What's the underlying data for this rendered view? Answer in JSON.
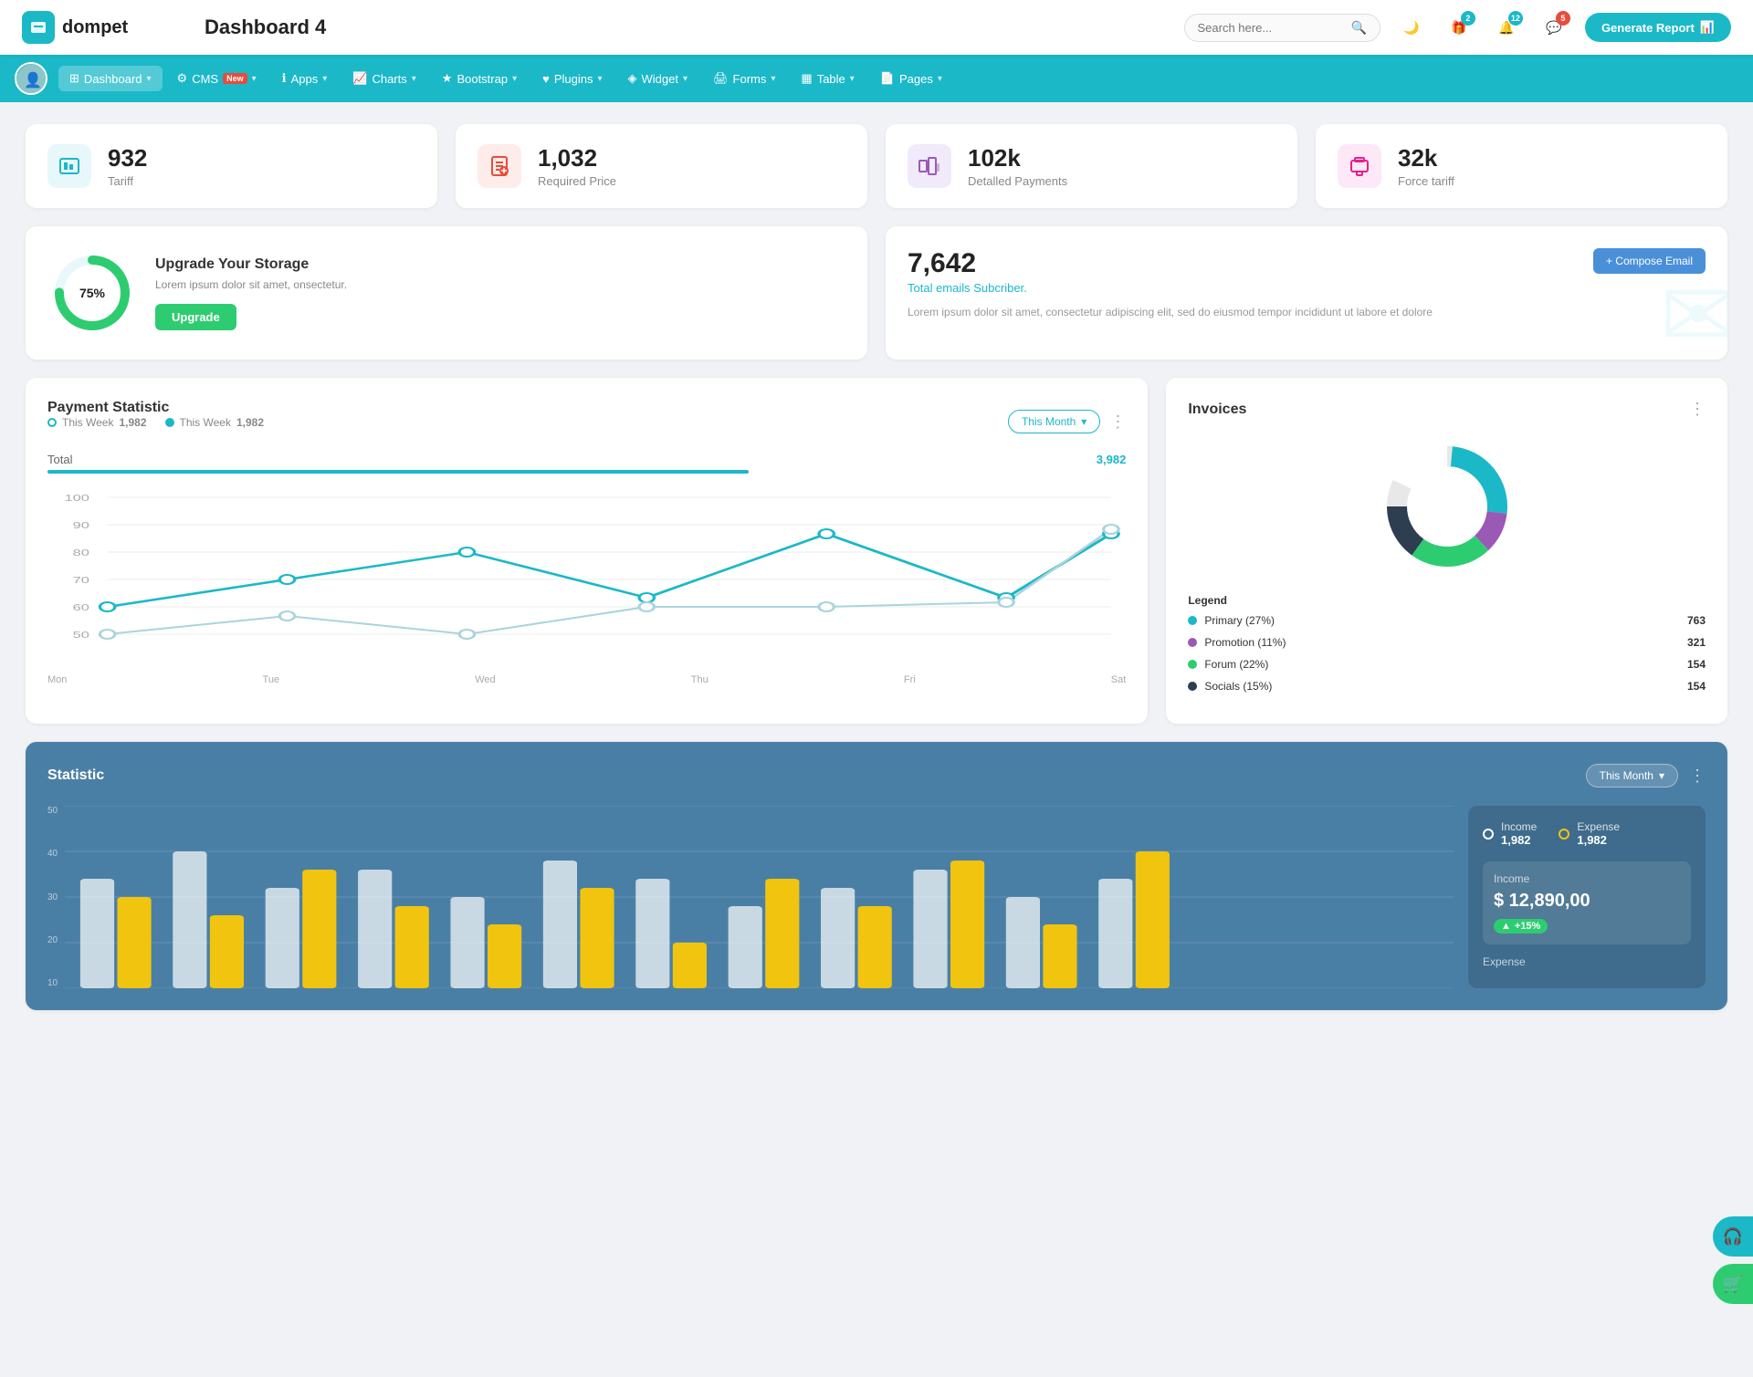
{
  "header": {
    "logo_text": "dompet",
    "page_title": "Dashboard 4",
    "search_placeholder": "Search here...",
    "generate_btn": "Generate Report",
    "icons": {
      "moon": "🌙",
      "gift": "🎁",
      "bell": "🔔",
      "chat": "💬"
    },
    "badges": {
      "gift": "2",
      "bell": "12",
      "chat": "5"
    }
  },
  "nav": {
    "items": [
      {
        "label": "Dashboard",
        "active": true,
        "has_dropdown": true
      },
      {
        "label": "CMS",
        "has_new": true,
        "has_dropdown": true
      },
      {
        "label": "Apps",
        "has_dropdown": true
      },
      {
        "label": "Charts",
        "has_dropdown": true
      },
      {
        "label": "Bootstrap",
        "has_dropdown": true
      },
      {
        "label": "Plugins",
        "has_dropdown": true
      },
      {
        "label": "Widget",
        "has_dropdown": true
      },
      {
        "label": "Forms",
        "has_dropdown": true
      },
      {
        "label": "Table",
        "has_dropdown": true
      },
      {
        "label": "Pages",
        "has_dropdown": true
      }
    ]
  },
  "stat_cards": [
    {
      "value": "932",
      "label": "Tariff",
      "icon_type": "teal"
    },
    {
      "value": "1,032",
      "label": "Required Price",
      "icon_type": "red"
    },
    {
      "value": "102k",
      "label": "Detalled Payments",
      "icon_type": "purple"
    },
    {
      "value": "32k",
      "label": "Force tariff",
      "icon_type": "pink"
    }
  ],
  "storage": {
    "percent": "75%",
    "title": "Upgrade Your Storage",
    "desc": "Lorem ipsum dolor sit amet, onsectetur.",
    "btn_label": "Upgrade"
  },
  "email": {
    "count": "7,642",
    "subtitle": "Total emails Subcriber.",
    "desc": "Lorem ipsum dolor sit amet, consectetur adipiscing elit, sed do eiusmod tempor incididunt ut labore et dolore",
    "btn_label": "+ Compose Email"
  },
  "payment": {
    "title": "Payment Statistic",
    "legend": [
      {
        "label": "This Week",
        "value": "1,982"
      },
      {
        "label": "This Week",
        "value": "1,982"
      }
    ],
    "this_month": "This Month",
    "total_label": "Total",
    "total_value": "3,982",
    "x_labels": [
      "Mon",
      "Tue",
      "Wed",
      "Thu",
      "Fri",
      "Sat"
    ]
  },
  "invoices": {
    "title": "Invoices",
    "legend": [
      {
        "label": "Primary (27%)",
        "value": "763",
        "color": "#1bb8c8"
      },
      {
        "label": "Promotion (11%)",
        "value": "321",
        "color": "#9b59b6"
      },
      {
        "label": "Forum (22%)",
        "value": "154",
        "color": "#2ecc71"
      },
      {
        "label": "Socials (15%)",
        "value": "154",
        "color": "#2c3e50"
      }
    ],
    "legend_title": "Legend"
  },
  "statistic": {
    "title": "Statistic",
    "this_month": "This Month",
    "income": {
      "label": "Income",
      "value": "1,982"
    },
    "expense": {
      "label": "Expense",
      "value": "1,982"
    },
    "income_box": {
      "label": "Income",
      "amount": "$ 12,890,00",
      "badge": "+15%"
    },
    "expense_label": "Expense",
    "y_labels": [
      "50",
      "40",
      "30",
      "20",
      "10"
    ]
  },
  "float_btns": {
    "headset": "🎧",
    "cart": "🛒"
  }
}
